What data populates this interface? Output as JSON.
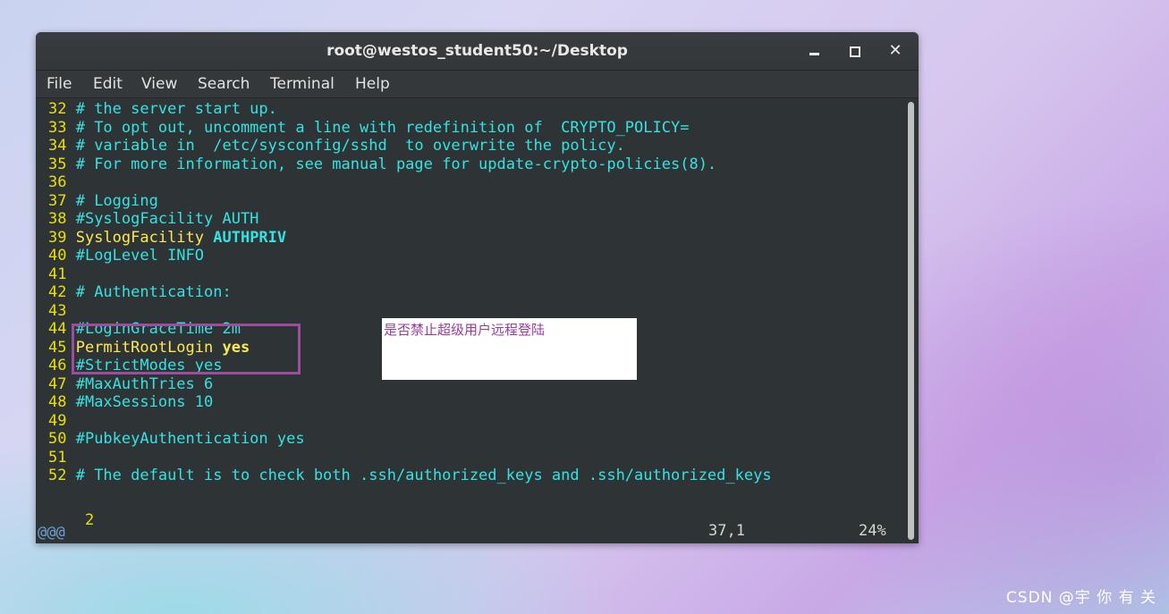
{
  "window": {
    "title": "root@westos_student50:~/Desktop",
    "controls": {
      "minimize": "–",
      "maximize": "□",
      "close": "✕"
    }
  },
  "menu": [
    "File",
    "Edit",
    "View",
    "Search",
    "Terminal",
    "Help"
  ],
  "lines": [
    {
      "num": "32",
      "segments": [
        {
          "text": " # the server start up.",
          "style": "comment"
        }
      ]
    },
    {
      "num": "33",
      "segments": [
        {
          "text": " # To opt out, uncomment a line with redefinition of  CRYPTO_POLICY=",
          "style": "comment"
        }
      ]
    },
    {
      "num": "34",
      "segments": [
        {
          "text": " # variable in  /etc/sysconfig/sshd  to overwrite the policy.",
          "style": "comment"
        }
      ]
    },
    {
      "num": "35",
      "segments": [
        {
          "text": " # For more information, see manual page for update-crypto-policies(8).",
          "style": "comment"
        }
      ]
    },
    {
      "num": "36",
      "segments": []
    },
    {
      "num": "37",
      "segments": [
        {
          "text": " # Logging",
          "style": "comment"
        }
      ]
    },
    {
      "num": "38",
      "segments": [
        {
          "text": " #SyslogFacility AUTH",
          "style": "comment"
        }
      ]
    },
    {
      "num": "39",
      "segments": [
        {
          "text": " SyslogFacility ",
          "style": "key"
        },
        {
          "text": "AUTHPRIV",
          "style": "val-cyan"
        }
      ]
    },
    {
      "num": "40",
      "segments": [
        {
          "text": " #LogLevel INFO",
          "style": "comment"
        }
      ]
    },
    {
      "num": "41",
      "segments": []
    },
    {
      "num": "42",
      "segments": [
        {
          "text": " # Authentication:",
          "style": "comment"
        }
      ]
    },
    {
      "num": "43",
      "segments": []
    },
    {
      "num": "44",
      "segments": [
        {
          "text": " #LoginGraceTime 2m",
          "style": "comment"
        }
      ]
    },
    {
      "num": "45",
      "segments": [
        {
          "text": " PermitRootLogin ",
          "style": "key"
        },
        {
          "text": "yes",
          "style": "val"
        }
      ]
    },
    {
      "num": "46",
      "segments": [
        {
          "text": " #StrictModes yes",
          "style": "comment"
        }
      ]
    },
    {
      "num": "47",
      "segments": [
        {
          "text": " #MaxAuthTries 6",
          "style": "comment"
        }
      ]
    },
    {
      "num": "48",
      "segments": [
        {
          "text": " #MaxSessions 10",
          "style": "comment"
        }
      ]
    },
    {
      "num": "49",
      "segments": []
    },
    {
      "num": "50",
      "segments": [
        {
          "text": " #PubkeyAuthentication yes",
          "style": "comment"
        }
      ]
    },
    {
      "num": "51",
      "segments": []
    },
    {
      "num": "52",
      "segments": [
        {
          "text": " # The default is to check both .ssh/authorized_keys and .ssh/authorized_keys",
          "style": "comment"
        }
      ]
    }
  ],
  "wrap_line": "2",
  "truncation_marker": "@@@",
  "status": {
    "position": "37,1",
    "percent": "24%"
  },
  "annotation": "是否禁止超级用户远程登陆",
  "watermark": "CSDN @宇 你 有 关",
  "colors": {
    "terminal_bg": "#2e3436",
    "line_number": "#e9e000",
    "comment": "#34e2e2",
    "keyword": "#fce94f",
    "highlight_border": "#9c4e9c"
  }
}
